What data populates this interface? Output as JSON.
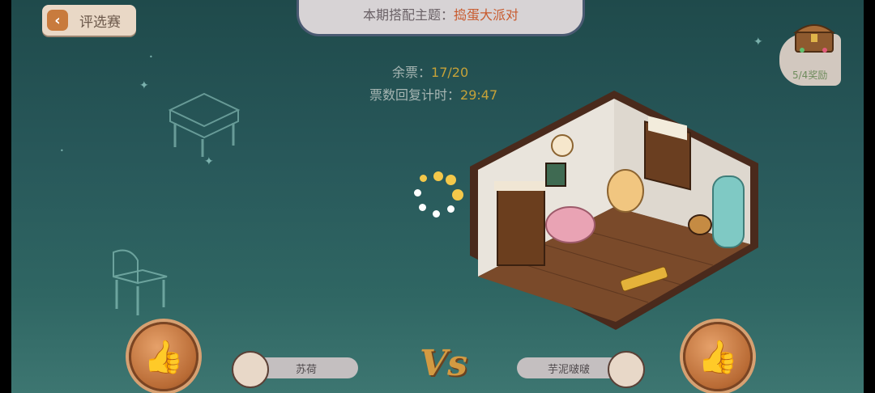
{
  "header": {
    "back_label": "评选赛",
    "theme_prefix": "本期搭配主题：",
    "theme_value": "捣蛋大派对"
  },
  "tickets": {
    "remaining_label": "余票：",
    "remaining_value": "17/20",
    "timer_label": "票数回复计时：",
    "timer_value": "29:47"
  },
  "reward": {
    "label": "5/4奖励"
  },
  "players": {
    "left_name": "苏荷",
    "right_name": "芋泥啵啵"
  },
  "colors": {
    "accent": "#c85a2d",
    "value_gold": "#c6a238",
    "thumb_bronze": "#b96b35"
  }
}
